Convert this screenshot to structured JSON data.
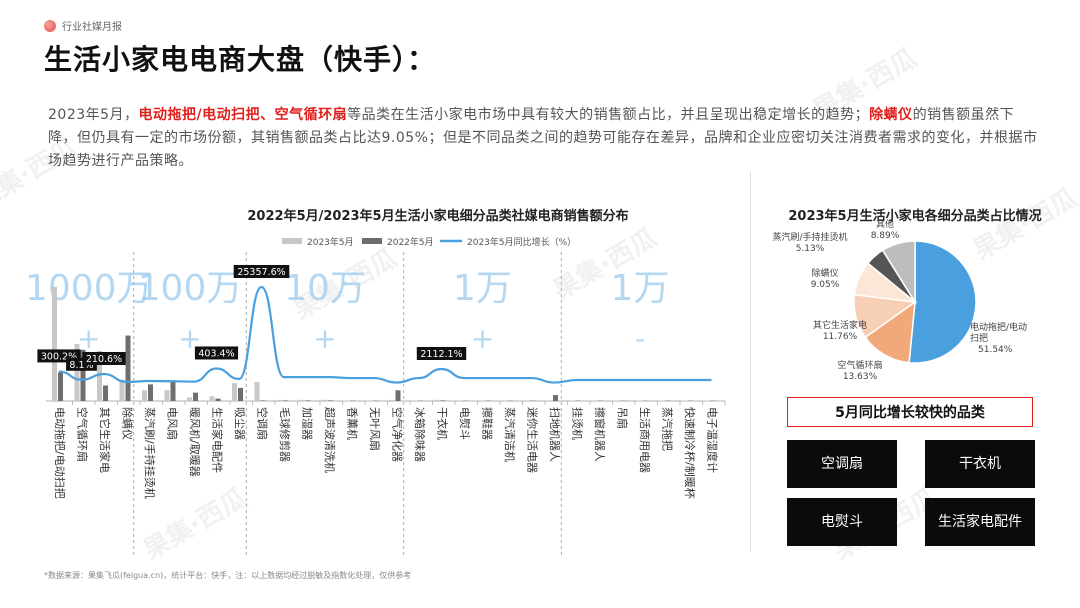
{
  "brand": {
    "name": "行业社媒月报"
  },
  "title": "生活小家电电商大盘（快手）：",
  "intro": {
    "p1": "2023年5月，",
    "hl1": "电动拖把/电动扫把、空气循环扇",
    "p2": "等品类在生活小家电市场中具有较大的销售额占比，并且呈现出稳定增长的趋势；",
    "hl2": "除螨仪",
    "p3": "的销售额虽然下降，但仍具有一定的市场份额，其销售额品类占比达9.05%；但是不同品类之间的趋势可能存在差异，品牌和企业应密切关注消费者需求的变化，并根据市场趋势进行产品策略。"
  },
  "footnote": "*数据来源：果集飞瓜(feigua.cn)，统计平台：快手，注：以上数据均经过脱敏及指数化处理，仅供参考",
  "colors": {
    "accent": "#e0201c",
    "bar2023": "#c8c8c8",
    "bar2022": "#6e6e6e",
    "line": "#4a9fdf"
  },
  "chart_data": [
    {
      "type": "bar",
      "title": "2022年5月/2023年5月生活小家电细分品类社媒电商销售额分布",
      "legend": [
        "2023年5月",
        "2022年5月",
        "2023年5月同比增长（%）"
      ],
      "legend_position": "top",
      "categories": [
        "电动拖把/电动扫把",
        "空气循环扇",
        "其它生活家电",
        "除螨仪",
        "蒸汽刷/手持挂烫机",
        "电风扇",
        "暖风机/取暖器",
        "生活家电配件",
        "吸尘器",
        "空调扇",
        "毛球修剪器",
        "加湿器",
        "超声波清洗机",
        "香薰机",
        "无叶风扇",
        "空气净化器",
        "冰箱除味器",
        "干衣机",
        "电熨斗",
        "擦鞋器",
        "蒸汽清洁机",
        "迷你生活电器",
        "扫地机器人",
        "挂烫机",
        "擦窗机器人",
        "吊扇",
        "生活商用电器",
        "蒸汽拖把",
        "快速制冷杯/制暖杯",
        "电子温湿度计"
      ],
      "series": [
        {
          "name": "2023年5月",
          "values": [
            96,
            48,
            42,
            18,
            9,
            9,
            3,
            4,
            15,
            16,
            1,
            1,
            1,
            0.5,
            0.5,
            1,
            0.5,
            1,
            0.5,
            0.5,
            0.5,
            0.5,
            0.5,
            0.3,
            0.3,
            0.3,
            0.3,
            0.3,
            0.3,
            0.3
          ]
        },
        {
          "name": "2022年5月",
          "values": [
            24,
            43,
            13,
            55,
            14,
            16,
            7,
            2,
            11,
            0.5,
            0.5,
            0.5,
            0.5,
            0.3,
            0.3,
            9,
            0.3,
            0.5,
            0.3,
            0.3,
            0.3,
            0.3,
            5,
            0.3,
            0.3,
            0.3,
            0.3,
            0.3,
            0.3,
            0.3
          ]
        },
        {
          "name": "2023年5月同比增长（%）",
          "values": [
            300.2,
            8.1,
            210.6,
            -67,
            -36,
            -44,
            -57,
            403.4,
            36,
            25357.6,
            100,
            100,
            100,
            67,
            67,
            -89,
            67,
            2112.1,
            67,
            67,
            67,
            67,
            -90,
            0,
            0,
            0,
            0,
            0,
            0,
            0
          ]
        }
      ],
      "data_labels": [
        {
          "index": 0,
          "text": "300.2%"
        },
        {
          "index": 1,
          "text": "8.1%"
        },
        {
          "index": 2,
          "text": "210.6%"
        },
        {
          "index": 7,
          "text": "403.4%"
        },
        {
          "index": 9,
          "text": "25357.6%"
        },
        {
          "index": 17,
          "text": "2112.1%"
        }
      ],
      "magnitude_groups": [
        {
          "label": "1000万+",
          "from": 0,
          "to": 3
        },
        {
          "label": "100万+",
          "from": 4,
          "to": 8
        },
        {
          "label": "10万+",
          "from": 9,
          "to": 15
        },
        {
          "label": "1万+",
          "from": 16,
          "to": 22
        },
        {
          "label": "1万-",
          "from": 23,
          "to": 29
        }
      ]
    },
    {
      "type": "pie",
      "title": "2023年5月生活小家电各细分品类占比情况",
      "slices": [
        {
          "label": "电动拖把/电动扫把",
          "value": 51.54,
          "value_label": "51.54%",
          "color": "#4a9fdf"
        },
        {
          "label": "空气循环扇",
          "value": 13.63,
          "value_label": "13.63%",
          "color": "#f2a97a"
        },
        {
          "label": "其它生活家电",
          "value": 11.76,
          "value_label": "11.76%",
          "color": "#f7cfb4"
        },
        {
          "label": "除螨仪",
          "value": 9.05,
          "value_label": "9.05%",
          "color": "#fbe6d8"
        },
        {
          "label": "蒸汽刷/手持挂烫机",
          "value": 5.13,
          "value_label": "5.13%",
          "color": "#555555"
        },
        {
          "label": "其他",
          "value": 8.89,
          "value_label": "8.89%",
          "color": "#bdbdbd"
        }
      ]
    }
  ],
  "fast_growth": {
    "title": "5月同比增长较快的品类",
    "items": [
      "空调扇",
      "干衣机",
      "电熨斗",
      "生活家电配件"
    ]
  },
  "watermark": {
    "text": "果集·西瓜"
  }
}
